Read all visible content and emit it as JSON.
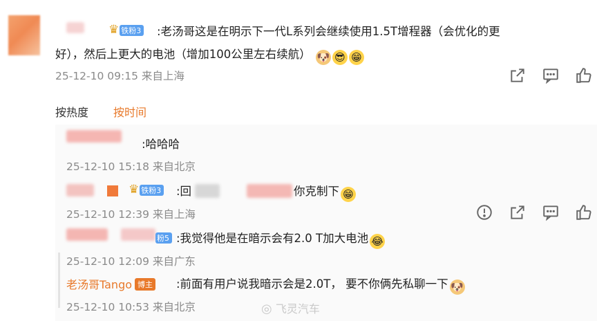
{
  "main_comment": {
    "badge": "铁粉3",
    "text_line1": ":老汤哥这是在明示下一代L系列会继续使用1.5T增程器（会优化的更",
    "text_line2": "好），然后上更大的电池（增加100公里左右续航）",
    "timestamp": "25-12-10 09:15",
    "location": "来自上海"
  },
  "sort": {
    "by_hot": "按热度",
    "by_time": "按时间"
  },
  "replies": [
    {
      "text": ":哈哈哈",
      "timestamp": "25-12-10 15:18",
      "location": "来自北京"
    },
    {
      "badge": "铁粉3",
      "text_prefix": ":回",
      "text_suffix": "你克制下",
      "timestamp": "25-12-10 12:39",
      "location": "来自上海"
    },
    {
      "badge": "粉5",
      "text": ":我觉得他是在暗示会有2.0 T加大电池",
      "timestamp": "25-12-10 12:09",
      "location": "来自广东"
    },
    {
      "author": "老汤哥Tango",
      "tag": "博主",
      "text": ":前面有用户说我暗示会是2.0T，  要不你俩先私聊一下",
      "timestamp": "25-12-10 10:53",
      "location": "来自北京"
    }
  ],
  "watermark": "飞灵汽车",
  "icons": [
    "share-icon",
    "comment-icon",
    "like-icon",
    "report-icon"
  ],
  "colors": {
    "accent": "#e8792a",
    "badge_blue": "#5aa0f0",
    "meta_gray": "#8a8a8a"
  }
}
